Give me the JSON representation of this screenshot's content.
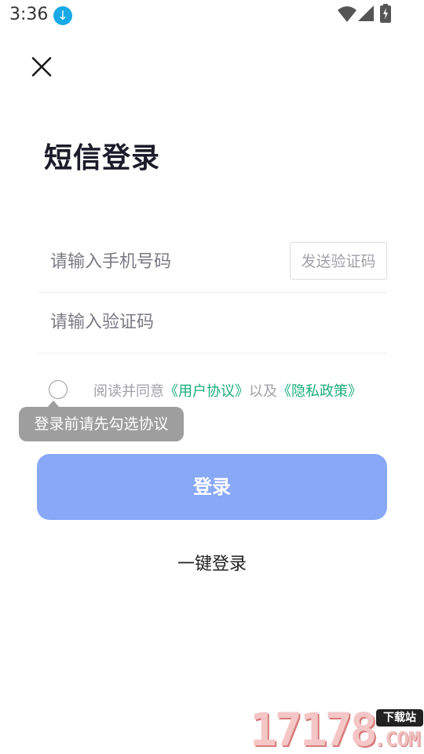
{
  "status_bar": {
    "time": "3:36",
    "icons": [
      "download-icon",
      "wifi-icon",
      "signal-icon",
      "battery-icon"
    ]
  },
  "header": {
    "close_icon": "close-icon",
    "title": "短信登录"
  },
  "form": {
    "phone_placeholder": "请输入手机号码",
    "send_code_label": "发送验证码",
    "code_placeholder": "请输入验证码"
  },
  "agreement": {
    "prefix": "阅读并同意",
    "user_agreement": "《用户协议》",
    "connector": "以及",
    "privacy_policy": "《隐私政策》",
    "checked": false
  },
  "tooltip": {
    "text": "登录前请先勾选协议"
  },
  "login_button": "登录",
  "one_click_login": "一键登录",
  "watermark": {
    "number": "17178",
    "badge": "下载站",
    "domain": ".COM"
  },
  "colors": {
    "login_button": "#88a8f8",
    "link": "#1aad7c",
    "tooltip": "#9e9e9e"
  }
}
